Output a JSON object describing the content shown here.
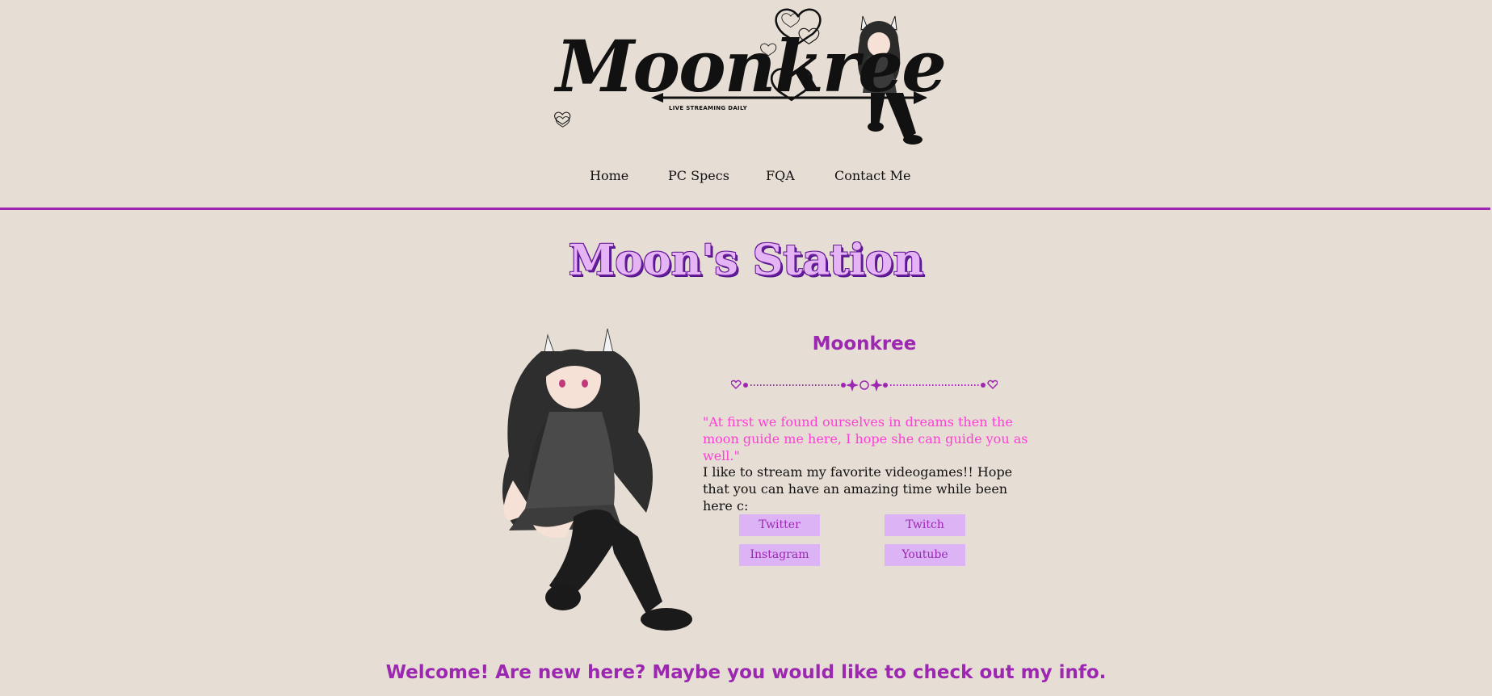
{
  "header": {
    "logo_text": "Moonkree",
    "logo_tagline": "LIVE STREAMING DAILY",
    "nav": [
      {
        "label": "Home"
      },
      {
        "label": "PC Specs"
      },
      {
        "label": "FQA"
      },
      {
        "label": "Contact Me"
      }
    ]
  },
  "main": {
    "site_title": "Moon's Station",
    "profile_name": "Moonkree",
    "quote": "\"At first we found ourselves in dreams then the moon guide me here, I hope she can guide you as well.\"",
    "bio": "I like to stream my favorite videogames!! Hope that you can have an amazing time while been here c:",
    "social_links": [
      {
        "label": "Twitter"
      },
      {
        "label": "Twitch"
      },
      {
        "label": "Instagram"
      },
      {
        "label": "Youtube"
      }
    ],
    "welcome": "Welcome! Are new here? Maybe you would like to check out my info."
  },
  "colors": {
    "background": "#e6ddd4",
    "accent": "#9c27b0",
    "quote": "#ff3fd6",
    "button_bg": "#dcb4f6"
  },
  "icons": [
    "heart-icon",
    "star-icon",
    "sun-icon",
    "arrow-icon"
  ]
}
